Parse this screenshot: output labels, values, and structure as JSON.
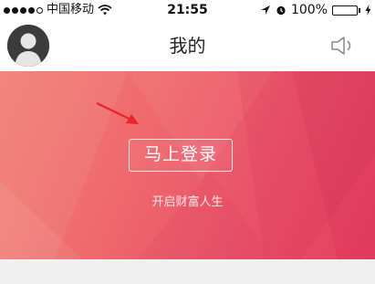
{
  "status_bar": {
    "carrier": "中国移动",
    "time": "21:55",
    "battery_percent": "100%",
    "battery_level": 1.0,
    "icons": [
      "signal-dots-icon",
      "wifi-icon",
      "location-arrow-icon",
      "alarm-icon",
      "battery-icon",
      "charging-icon"
    ]
  },
  "nav": {
    "title": "我的",
    "left_icon": "avatar",
    "right_icon": "speaker-icon"
  },
  "banner": {
    "login_label": "马上登录",
    "subtitle": "开启财富人生",
    "annotation_icon": "red-arrow-icon"
  },
  "colors": {
    "banner_gradient": [
      "#f37e73",
      "#e4405e"
    ],
    "annotation_arrow": "#e8232b",
    "battery_fill": "#2ecc40"
  }
}
